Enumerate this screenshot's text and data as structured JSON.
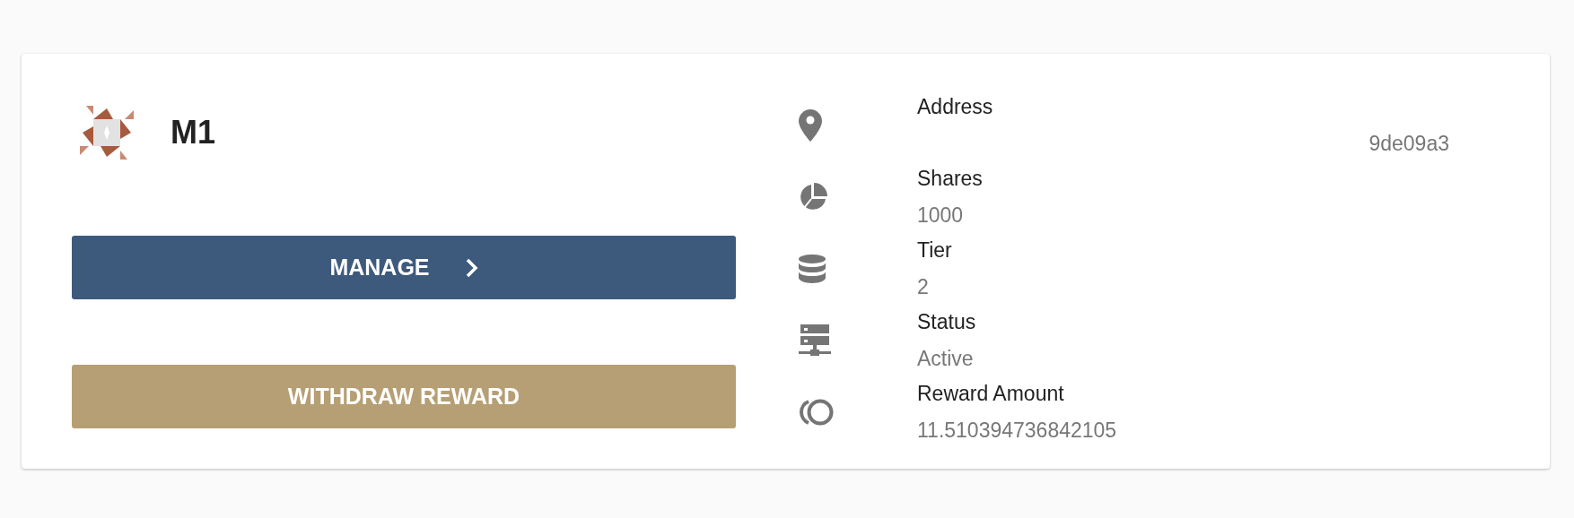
{
  "node": {
    "name": "M1"
  },
  "buttons": [
    {
      "label": "MANAGE",
      "kind": "primary"
    },
    {
      "label": "WITHDRAW REWARD",
      "kind": "secondary"
    }
  ],
  "details": [
    {
      "kind": "location",
      "label": "Address",
      "value": "9de09a3",
      "right_aligned": true
    },
    {
      "kind": "pie",
      "label": "Shares",
      "value": "1000"
    },
    {
      "kind": "database",
      "label": "Tier",
      "value": "2"
    },
    {
      "kind": "server",
      "label": "Status",
      "value": "Active"
    },
    {
      "kind": "coin",
      "label": "Reward Amount",
      "value": "11.510394736842105"
    }
  ]
}
